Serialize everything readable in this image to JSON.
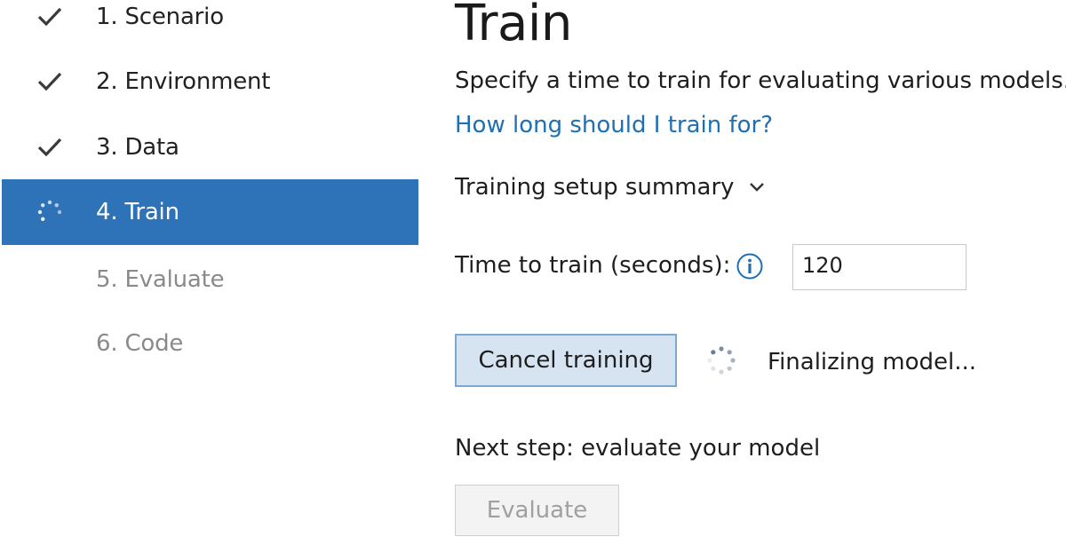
{
  "steps": [
    {
      "label": "1. Scenario",
      "state": "done"
    },
    {
      "label": "2. Environment",
      "state": "done"
    },
    {
      "label": "3. Data",
      "state": "done"
    },
    {
      "label": "4. Train",
      "state": "active"
    },
    {
      "label": "5. Evaluate",
      "state": "pending"
    },
    {
      "label": "6. Code",
      "state": "pending"
    }
  ],
  "main": {
    "title": "Train",
    "description": "Specify a time to train for evaluating various models.",
    "help_link": "How long should I train for?",
    "summary_label": "Training setup summary",
    "time_label": "Time to train (seconds):",
    "time_value": "120",
    "cancel_button": "Cancel training",
    "status_text": "Finalizing model...",
    "next_step_label": "Next step: evaluate your model",
    "evaluate_button": "Evaluate"
  },
  "colors": {
    "active_step_bg": "#2e73b8",
    "link": "#1f6fb5",
    "cancel_button_bg": "#d6e4f2",
    "cancel_button_border": "#7ba7d1"
  },
  "icons": {
    "done": "checkmark-icon",
    "active": "spinner-icon",
    "info": "info-icon",
    "summary": "chevron-down-icon"
  }
}
